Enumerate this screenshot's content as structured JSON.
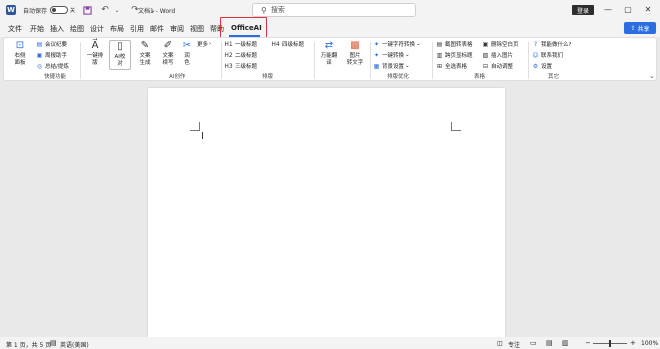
{
  "titlebar": {
    "autosave_label": "自动保存",
    "autosave_state": "关",
    "doc_title": "文档1  -  Word",
    "search_placeholder": "搜索",
    "login_label": "登录",
    "icons": [
      "word-app-icon",
      "save-icon",
      "undo-icon",
      "redo-icon",
      "customize-icon"
    ]
  },
  "menu": {
    "tabs": [
      "文件",
      "开始",
      "插入",
      "绘图",
      "设计",
      "布局",
      "引用",
      "邮件",
      "审阅",
      "视图",
      "帮助",
      "OfficeAI"
    ],
    "active_tab": "OfficeAI",
    "share_label": "共享"
  },
  "ribbon": {
    "g1": {
      "name": "快捷功能",
      "right_panel": "右侧\n面板",
      "items": [
        "会议纪要",
        "周报助手",
        "总结/提炼"
      ]
    },
    "g2": {
      "name": "AI创作",
      "buttons": [
        "一键排\n版",
        "AI校\n对",
        "文案\n生成",
        "文案\n续写",
        "润\n色"
      ],
      "more": "更多"
    },
    "g3": {
      "name": "排版",
      "headings": [
        "一级标题",
        "二级标题",
        "三级标题",
        "四级标题"
      ]
    },
    "g4": {
      "big_buttons": [
        "万能翻\n译",
        "图片\n转文字"
      ]
    },
    "g5": {
      "name": "排版优化",
      "items": [
        "一键字符转换",
        "一键转换",
        "背景设置"
      ]
    },
    "g6": {
      "name": "表格",
      "items": [
        "截图转表格",
        "删除空白页",
        "跨页显标题",
        "插入图片",
        "全选表格",
        "自动调整"
      ]
    },
    "g7": {
      "name": "其它",
      "items": [
        "我能做什么?",
        "联系我们",
        "设置"
      ]
    }
  },
  "statusbar": {
    "page": "第 1 页，共 5 页",
    "language": "英语(美国)",
    "focus": "专注",
    "zoom": "100%",
    "zoom_level": 1.0
  },
  "colors": {
    "accent": "#2b6ee0",
    "active_tab_outline": "#d9343b",
    "title_bg": "#f3f3f3",
    "canvas_bg": "#e9e9e9"
  }
}
